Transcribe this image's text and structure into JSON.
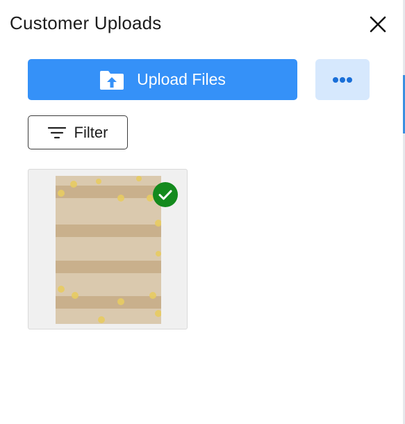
{
  "header": {
    "title": "Customer Uploads",
    "close_icon": "close-icon"
  },
  "toolbar": {
    "upload_label": "Upload Files",
    "upload_icon": "folder-upload-icon",
    "more_icon": "more-horizontal-icon",
    "filter_label": "Filter",
    "filter_icon": "filter-lines-icon"
  },
  "files": [
    {
      "thumbnail": "kraft-paper-stripes-with-gold-dots",
      "selected": true,
      "status_icon": "check-circle-icon"
    }
  ],
  "colors": {
    "primary": "#3591f8",
    "secondary_bg": "#d6e8fd",
    "success": "#148a1d",
    "text": "#1c1c1c"
  }
}
